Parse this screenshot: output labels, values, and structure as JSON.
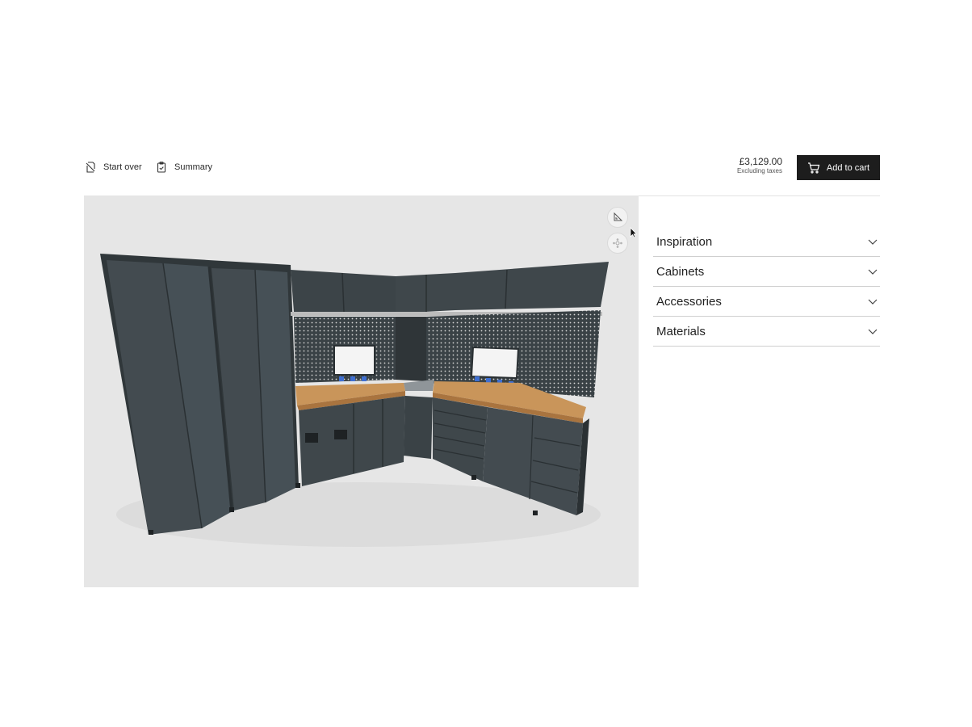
{
  "toolbar": {
    "start_over_label": "Start over",
    "summary_label": "Summary",
    "price": "£3,129.00",
    "price_note": "Excluding taxes",
    "add_to_cart_label": "Add to cart"
  },
  "viewer": {
    "tools": [
      {
        "name": "measure-icon"
      },
      {
        "name": "explode-icon"
      }
    ]
  },
  "panel": {
    "sections": [
      {
        "label": "Inspiration"
      },
      {
        "label": "Cabinets"
      },
      {
        "label": "Accessories"
      },
      {
        "label": "Materials"
      }
    ]
  },
  "colors": {
    "cabinet": "#3f474b",
    "cabinet_dark": "#30373a",
    "worktop": "#c9955a",
    "viewer_bg": "#e6e6e6",
    "cart_button": "#1d1d1d",
    "tool_handle": "#3f6fd1"
  }
}
